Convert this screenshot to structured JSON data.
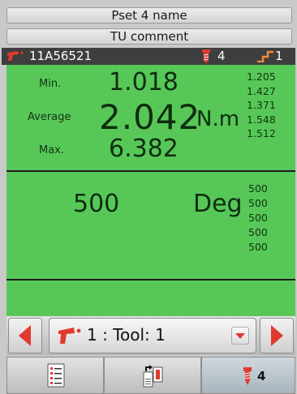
{
  "header": {
    "pset_name": "Pset 4 name",
    "tu_comment": "TU comment"
  },
  "status_bar": {
    "tool_id": "11A56521",
    "batch_count": "4",
    "step_count": "1"
  },
  "torque": {
    "min_label": "Min.",
    "min_value": "1.018",
    "avg_label": "Average",
    "avg_value": "2.042",
    "unit": "N.m",
    "max_label": "Max.",
    "max_value": "6.382",
    "recent": [
      "1.205",
      "1.427",
      "1.371",
      "1.548",
      "1.512"
    ]
  },
  "angle": {
    "value": "500",
    "unit": "Deg",
    "recent": [
      "500",
      "500",
      "500",
      "500",
      "500"
    ]
  },
  "tool_selector": {
    "label": "1 : Tool: 1"
  },
  "bottom_tabs": {
    "batch_count": "4"
  },
  "colors": {
    "panel_green": "#57c858",
    "accent_red": "#e03a2e",
    "status_bar": "#3e3e3e"
  }
}
